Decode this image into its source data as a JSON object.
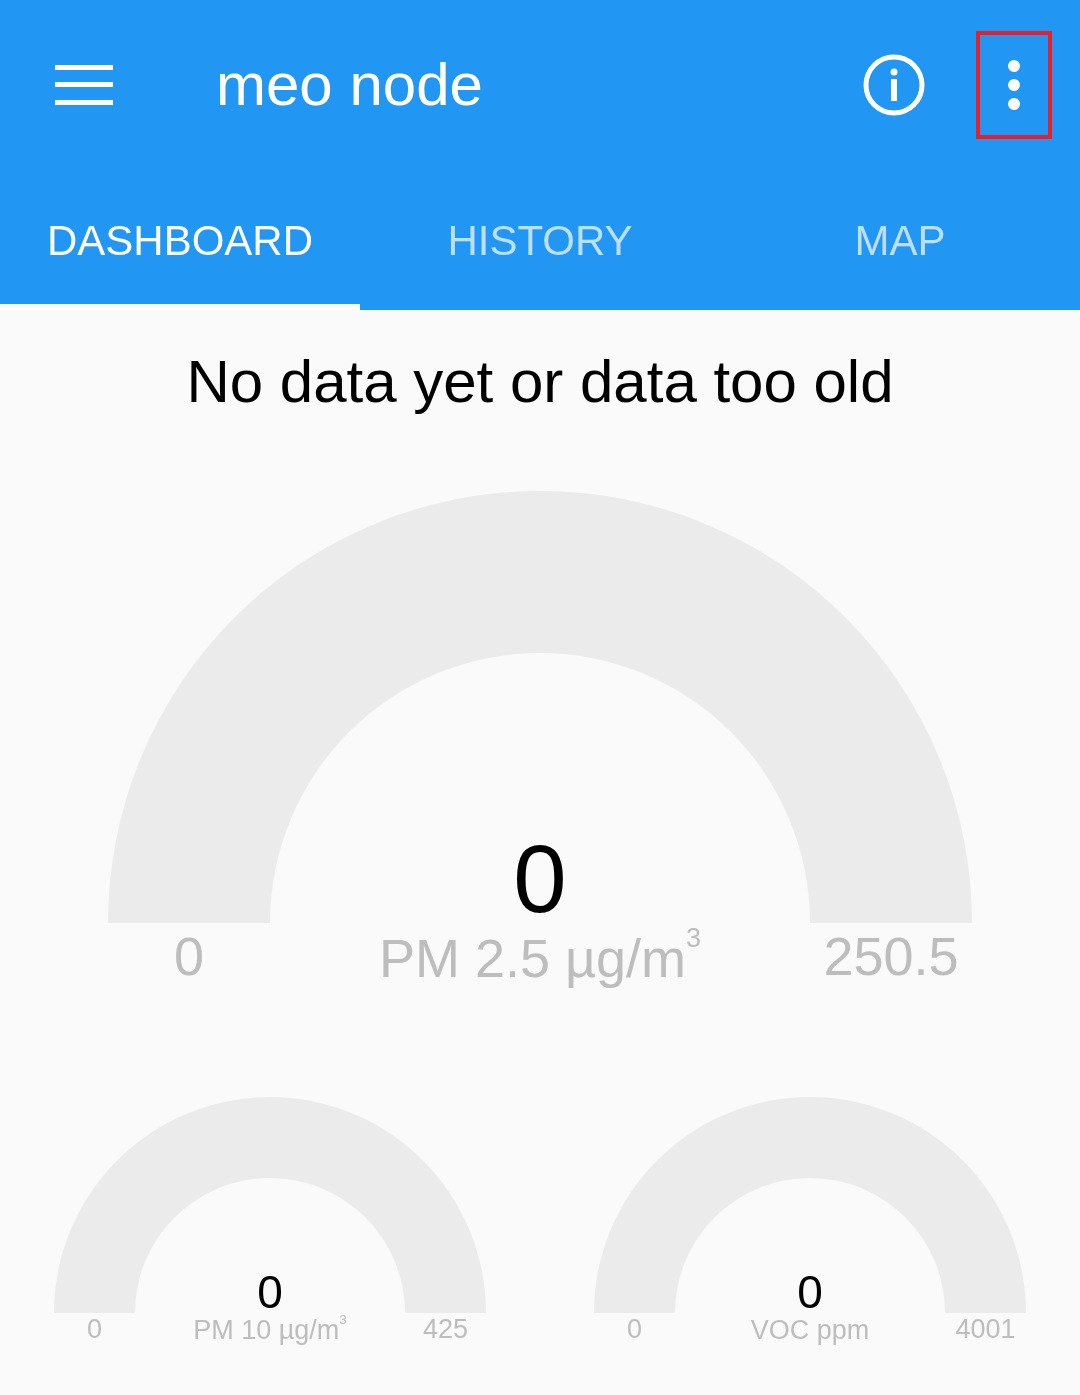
{
  "app_bar": {
    "title": "meo node",
    "menu_highlighted": true
  },
  "tabs": [
    {
      "label": "DASHBOARD",
      "selected": true
    },
    {
      "label": "HISTORY",
      "selected": false
    },
    {
      "label": "MAP",
      "selected": false
    }
  ],
  "status_message": "No data yet or data too old",
  "gauges": [
    {
      "kind": "large",
      "value": "0",
      "min": "0",
      "unit": "PM 2.5 µg/m$^{3}$",
      "max": "250.5"
    },
    {
      "kind": "small",
      "value": "0",
      "min": "0",
      "unit": "PM 10 µg/m$^{3}$",
      "max": "425"
    },
    {
      "kind": "small",
      "value": "0",
      "min": "0",
      "unit": "VOC ppm",
      "max": "4001"
    }
  ]
}
